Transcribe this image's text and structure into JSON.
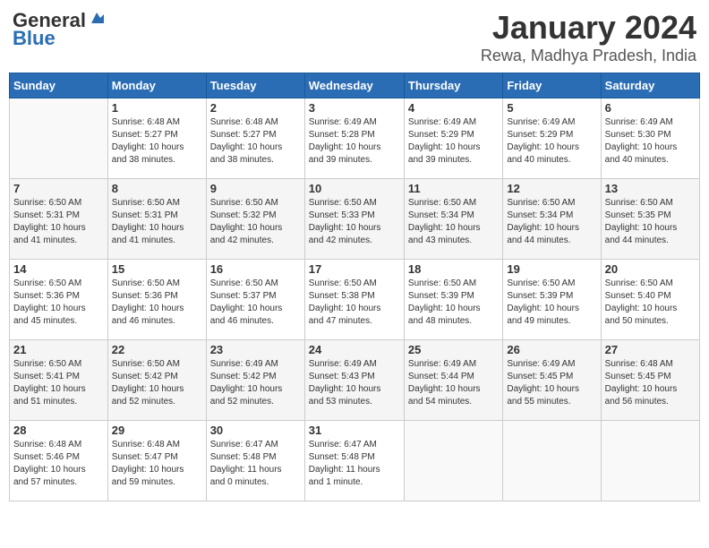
{
  "header": {
    "logo_general": "General",
    "logo_blue": "Blue",
    "main_title": "January 2024",
    "sub_title": "Rewa, Madhya Pradesh, India"
  },
  "calendar": {
    "days_of_week": [
      "Sunday",
      "Monday",
      "Tuesday",
      "Wednesday",
      "Thursday",
      "Friday",
      "Saturday"
    ],
    "weeks": [
      [
        {
          "day": "",
          "info": ""
        },
        {
          "day": "1",
          "info": "Sunrise: 6:48 AM\nSunset: 5:27 PM\nDaylight: 10 hours\nand 38 minutes."
        },
        {
          "day": "2",
          "info": "Sunrise: 6:48 AM\nSunset: 5:27 PM\nDaylight: 10 hours\nand 38 minutes."
        },
        {
          "day": "3",
          "info": "Sunrise: 6:49 AM\nSunset: 5:28 PM\nDaylight: 10 hours\nand 39 minutes."
        },
        {
          "day": "4",
          "info": "Sunrise: 6:49 AM\nSunset: 5:29 PM\nDaylight: 10 hours\nand 39 minutes."
        },
        {
          "day": "5",
          "info": "Sunrise: 6:49 AM\nSunset: 5:29 PM\nDaylight: 10 hours\nand 40 minutes."
        },
        {
          "day": "6",
          "info": "Sunrise: 6:49 AM\nSunset: 5:30 PM\nDaylight: 10 hours\nand 40 minutes."
        }
      ],
      [
        {
          "day": "7",
          "info": "Sunrise: 6:50 AM\nSunset: 5:31 PM\nDaylight: 10 hours\nand 41 minutes."
        },
        {
          "day": "8",
          "info": "Sunrise: 6:50 AM\nSunset: 5:31 PM\nDaylight: 10 hours\nand 41 minutes."
        },
        {
          "day": "9",
          "info": "Sunrise: 6:50 AM\nSunset: 5:32 PM\nDaylight: 10 hours\nand 42 minutes."
        },
        {
          "day": "10",
          "info": "Sunrise: 6:50 AM\nSunset: 5:33 PM\nDaylight: 10 hours\nand 42 minutes."
        },
        {
          "day": "11",
          "info": "Sunrise: 6:50 AM\nSunset: 5:34 PM\nDaylight: 10 hours\nand 43 minutes."
        },
        {
          "day": "12",
          "info": "Sunrise: 6:50 AM\nSunset: 5:34 PM\nDaylight: 10 hours\nand 44 minutes."
        },
        {
          "day": "13",
          "info": "Sunrise: 6:50 AM\nSunset: 5:35 PM\nDaylight: 10 hours\nand 44 minutes."
        }
      ],
      [
        {
          "day": "14",
          "info": "Sunrise: 6:50 AM\nSunset: 5:36 PM\nDaylight: 10 hours\nand 45 minutes."
        },
        {
          "day": "15",
          "info": "Sunrise: 6:50 AM\nSunset: 5:36 PM\nDaylight: 10 hours\nand 46 minutes."
        },
        {
          "day": "16",
          "info": "Sunrise: 6:50 AM\nSunset: 5:37 PM\nDaylight: 10 hours\nand 46 minutes."
        },
        {
          "day": "17",
          "info": "Sunrise: 6:50 AM\nSunset: 5:38 PM\nDaylight: 10 hours\nand 47 minutes."
        },
        {
          "day": "18",
          "info": "Sunrise: 6:50 AM\nSunset: 5:39 PM\nDaylight: 10 hours\nand 48 minutes."
        },
        {
          "day": "19",
          "info": "Sunrise: 6:50 AM\nSunset: 5:39 PM\nDaylight: 10 hours\nand 49 minutes."
        },
        {
          "day": "20",
          "info": "Sunrise: 6:50 AM\nSunset: 5:40 PM\nDaylight: 10 hours\nand 50 minutes."
        }
      ],
      [
        {
          "day": "21",
          "info": "Sunrise: 6:50 AM\nSunset: 5:41 PM\nDaylight: 10 hours\nand 51 minutes."
        },
        {
          "day": "22",
          "info": "Sunrise: 6:50 AM\nSunset: 5:42 PM\nDaylight: 10 hours\nand 52 minutes."
        },
        {
          "day": "23",
          "info": "Sunrise: 6:49 AM\nSunset: 5:42 PM\nDaylight: 10 hours\nand 52 minutes."
        },
        {
          "day": "24",
          "info": "Sunrise: 6:49 AM\nSunset: 5:43 PM\nDaylight: 10 hours\nand 53 minutes."
        },
        {
          "day": "25",
          "info": "Sunrise: 6:49 AM\nSunset: 5:44 PM\nDaylight: 10 hours\nand 54 minutes."
        },
        {
          "day": "26",
          "info": "Sunrise: 6:49 AM\nSunset: 5:45 PM\nDaylight: 10 hours\nand 55 minutes."
        },
        {
          "day": "27",
          "info": "Sunrise: 6:48 AM\nSunset: 5:45 PM\nDaylight: 10 hours\nand 56 minutes."
        }
      ],
      [
        {
          "day": "28",
          "info": "Sunrise: 6:48 AM\nSunset: 5:46 PM\nDaylight: 10 hours\nand 57 minutes."
        },
        {
          "day": "29",
          "info": "Sunrise: 6:48 AM\nSunset: 5:47 PM\nDaylight: 10 hours\nand 59 minutes."
        },
        {
          "day": "30",
          "info": "Sunrise: 6:47 AM\nSunset: 5:48 PM\nDaylight: 11 hours\nand 0 minutes."
        },
        {
          "day": "31",
          "info": "Sunrise: 6:47 AM\nSunset: 5:48 PM\nDaylight: 11 hours\nand 1 minute."
        },
        {
          "day": "",
          "info": ""
        },
        {
          "day": "",
          "info": ""
        },
        {
          "day": "",
          "info": ""
        }
      ]
    ]
  }
}
